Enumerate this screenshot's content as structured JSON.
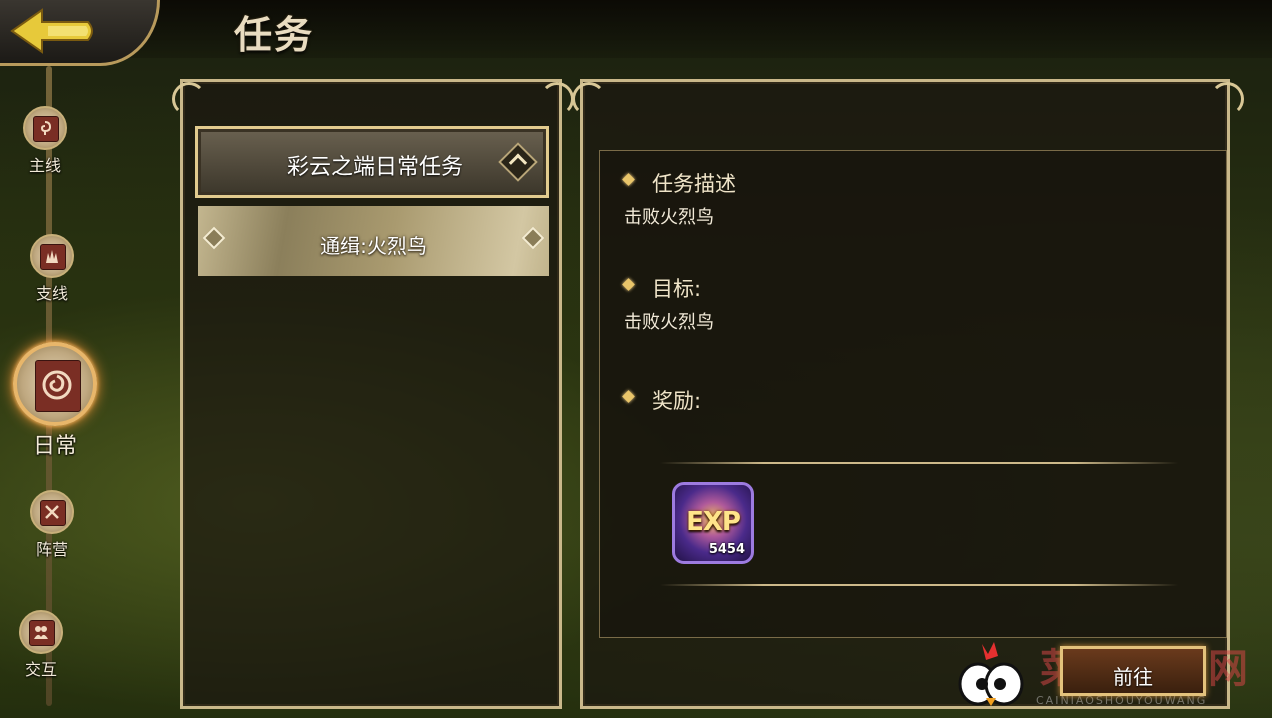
{
  "header": {
    "title": "任务"
  },
  "nav": {
    "items": [
      {
        "label": "主线",
        "icon": "scroll-spiral-icon"
      },
      {
        "label": "支线",
        "icon": "scroll-flame-icon"
      },
      {
        "label": "日常",
        "icon": "scroll-swirl-icon",
        "active": true
      },
      {
        "label": "阵营",
        "icon": "scroll-crossed-swords-icon"
      },
      {
        "label": "交互",
        "icon": "scroll-people-icon"
      }
    ]
  },
  "quest_list": {
    "group_label": "彩云之端日常任务",
    "items": [
      {
        "label": "通缉:火烈鸟"
      }
    ]
  },
  "detail": {
    "description_heading": "任务描述",
    "description_text": "击败火烈鸟",
    "target_heading": "目标:",
    "target_text": "击败火烈鸟",
    "reward_heading": "奖励:",
    "reward": {
      "label": "EXP",
      "amount": "5454"
    }
  },
  "actions": {
    "go_label": "前往"
  },
  "watermark": {
    "text": "菜鸟手游网",
    "sub": "CAINIAOSHOUYOUWANG"
  },
  "colors": {
    "accent_gold": "#c9b88a",
    "active_glow": "#ff9a3a",
    "exp_purple": "#4a2a8a"
  }
}
